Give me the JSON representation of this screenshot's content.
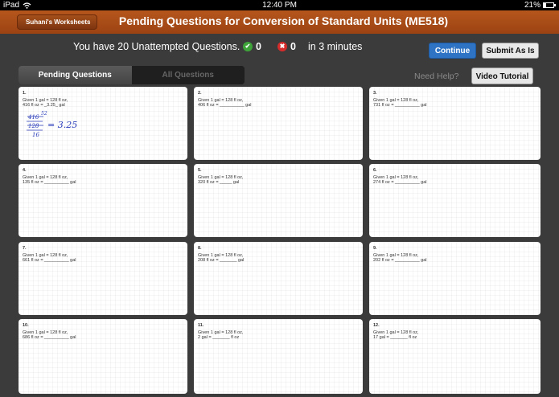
{
  "status": {
    "device": "iPad",
    "wifi_icon": "wifi-icon",
    "time": "12:40 PM",
    "battery": "21%",
    "battery_level": 0.21
  },
  "nav": {
    "back_label": "Suhani's Worksheets",
    "title": "Pending Questions for Conversion of Standard Units (ME518)"
  },
  "summary": {
    "message": "You have 20 Unattempted Questions.",
    "correct_count": "0",
    "wrong_count": "0",
    "time": "in 3 minutes"
  },
  "actions": {
    "continue": "Continue",
    "submit": "Submit As Is",
    "need_help": "Need Help?",
    "video": "Video Tutorial"
  },
  "tabs": {
    "pending": "Pending Questions",
    "all": "All Questions"
  },
  "questions": [
    {
      "num": "1.",
      "line1": "Given 1 gal = 128 fl oz,",
      "line2": "416 fl oz = _3.25_ gal"
    },
    {
      "num": "2.",
      "line1": "Given 1 gal = 128 fl oz,",
      "line2": "406 fl oz = __________ gal"
    },
    {
      "num": "3.",
      "line1": "Given 1 gal = 128 fl oz,",
      "line2": "731 fl oz = __________ gal"
    },
    {
      "num": "4.",
      "line1": "Given 1 gal = 128 fl oz,",
      "line2": "135 fl oz = __________ gal"
    },
    {
      "num": "5.",
      "line1": "Given 1 gal = 128 fl oz,",
      "line2": "320 fl oz = _____ gal"
    },
    {
      "num": "6.",
      "line1": "Given 1 gal = 128 fl oz,",
      "line2": "274 fl oz = __________ gal"
    },
    {
      "num": "7.",
      "line1": "Given 1 gal = 128 fl oz,",
      "line2": "661 fl oz = __________ gal"
    },
    {
      "num": "8.",
      "line1": "Given 1 gal = 128 fl oz,",
      "line2": "208 fl oz = _______ gal"
    },
    {
      "num": "9.",
      "line1": "Given 1 gal = 128 fl oz,",
      "line2": "202 fl oz = __________ gal"
    },
    {
      "num": "10.",
      "line1": "Given 1 gal = 128 fl oz,",
      "line2": "686 fl oz = __________ gal"
    },
    {
      "num": "11.",
      "line1": "Given 1 gal = 128 fl oz,",
      "line2": "2 gal = _______ fl oz"
    },
    {
      "num": "12.",
      "line1": "Given 1 gal = 128 fl oz,",
      "line2": "17 gal = _______ fl oz"
    }
  ],
  "handwriting": {
    "top": "416",
    "super": "52",
    "bottom": "128",
    "bottom2": "16",
    "result": "= 3.25"
  }
}
